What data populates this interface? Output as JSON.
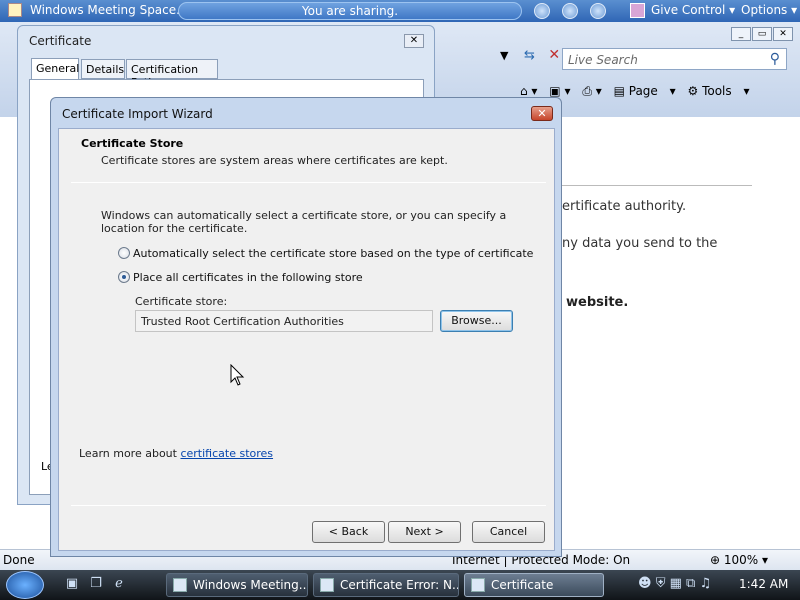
{
  "meeting_bar": {
    "title": "Windows Meeting Space...",
    "sharing": "You are sharing.",
    "give_control": "Give Control",
    "options": "Options"
  },
  "ie": {
    "search_placeholder": "Live Search",
    "cmd": {
      "page": "Page",
      "tools": "Tools"
    },
    "content": {
      "line1": "ertificate authority.",
      "line2": "ny data you send to the",
      "line3": "website."
    },
    "status": {
      "done": "Done",
      "zone": "Internet | Protected Mode: On",
      "zoom": "100%"
    }
  },
  "cert_window": {
    "title": "Certificate",
    "tabs": [
      "General",
      "Details",
      "Certification Path"
    ],
    "partial_text": "Le"
  },
  "wizard": {
    "title": "Certificate Import Wizard",
    "section_title": "Certificate Store",
    "section_desc": "Certificate stores are system areas where certificates are kept.",
    "para": "Windows can automatically select a certificate store, or you can specify a location for the certificate.",
    "radio_auto": "Automatically select the certificate store based on the type of certificate",
    "radio_manual": "Place all certificates in the following store",
    "store_label": "Certificate store:",
    "store_value": "Trusted Root Certification Authorities",
    "browse": "Browse...",
    "learn_prefix": "Learn more about ",
    "learn_link": "certificate stores",
    "back": "< Back",
    "next": "Next >",
    "cancel": "Cancel"
  },
  "taskbar": {
    "tasks": [
      "Windows Meeting...",
      "Certificate Error: N...",
      "Certificate"
    ],
    "clock": "1:42 AM"
  }
}
